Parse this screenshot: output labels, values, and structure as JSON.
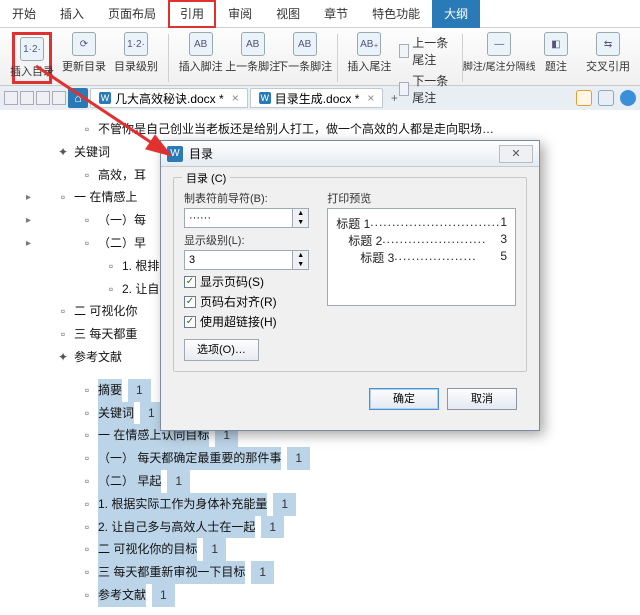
{
  "menu": {
    "items": [
      "开始",
      "插入",
      "页面布局",
      "引用",
      "审阅",
      "视图",
      "章节",
      "特色功能",
      "大纲"
    ],
    "highlight_index": 3,
    "active_index": 8
  },
  "ribbon": {
    "insert_toc": "插入目录",
    "update_toc": "更新目录",
    "toc_level": "目录级别",
    "ins_footnote": "插入脚注",
    "prev_footnote": "上一条脚注",
    "next_footnote": "下一条脚注",
    "ins_endnote": "插入尾注",
    "prev_endnote": "上一条尾注",
    "next_endnote": "下一条尾注",
    "sep": "脚注/尾注分隔线",
    "caption": "题注",
    "cross": "交叉引用",
    "ab": "AB",
    "abp": "AB₊",
    "icon_num": "1·2·"
  },
  "tabs": {
    "file1": "几大高效秘诀.docx *",
    "file2": "目录生成.docx *"
  },
  "doc": {
    "l1": "不管你是自己创业当老板还是给别人打工，做一个高效的人都是走向职场…",
    "l2": "关键词",
    "l3": "高效，耳",
    "l4": "一  在情感上",
    "l5": "（一）每",
    "l6": "（二）早",
    "l7": "1. 根排",
    "l8": "2. 让自",
    "l9": "二  可视化你",
    "l10": "三  每天都重",
    "l11": "参考文献",
    "s1": "摘要",
    "s1n": "1",
    "s2": "关键词",
    "s2n": "1",
    "s3": "一  在情感上认同目标",
    "s3n": "1",
    "s4": "（一）  每天都确定最重要的那件事",
    "s4n": "1",
    "s5": "（二）  早起",
    "s5n": "1",
    "s6": "1. 根据实际工作为身体补充能量",
    "s6n": "1",
    "s7": "2. 让自己多与高效人士在一起",
    "s7n": "1",
    "s8": "二  可视化你的目标",
    "s8n": "1",
    "s9": "三  每天都重新审视一下目标",
    "s9n": "1",
    "s10": "参考文献",
    "s10n": "1"
  },
  "dialog": {
    "title": "目录",
    "group": "目录 (C)",
    "leader_label": "制表符前导符(B):",
    "leader_value": "······",
    "level_label": "显示级别(L):",
    "level_value": "3",
    "cb1": "显示页码(S)",
    "cb2": "页码右对齐(R)",
    "cb3": "使用超链接(H)",
    "preview_label": "打印预览",
    "p1": "标题 1",
    "p1n": "1",
    "p2": "标题 2",
    "p2n": "3",
    "p3": "标题 3",
    "p3n": "5",
    "options": "选项(O)…",
    "ok": "确定",
    "cancel": "取消"
  }
}
